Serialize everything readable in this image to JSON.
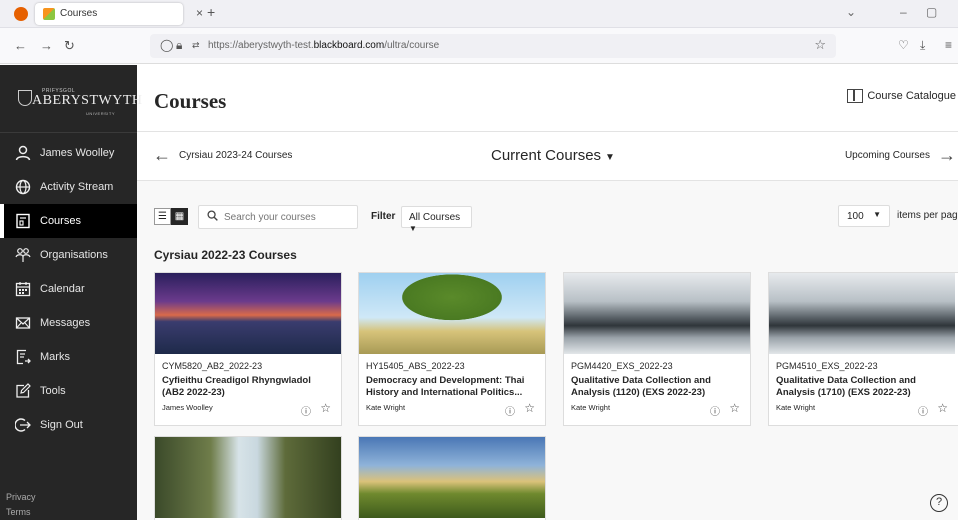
{
  "browser": {
    "tab_title": "Courses",
    "url_prefix": "https://aberystwyth-test.",
    "url_domain": "blackboard.com",
    "url_suffix": "/ultra/course"
  },
  "brand": {
    "small": "PRIFYSGOL",
    "name": "ABERYSTWYTH",
    "sub": "UNIVERSITY"
  },
  "sidebar": {
    "items": [
      {
        "label": "James Woolley",
        "icon": "user-icon"
      },
      {
        "label": "Activity Stream",
        "icon": "globe-icon"
      },
      {
        "label": "Courses",
        "icon": "courses-icon",
        "active": true
      },
      {
        "label": "Organisations",
        "icon": "organisations-icon"
      },
      {
        "label": "Calendar",
        "icon": "calendar-icon"
      },
      {
        "label": "Messages",
        "icon": "envelope-icon"
      },
      {
        "label": "Marks",
        "icon": "marks-icon"
      },
      {
        "label": "Tools",
        "icon": "tools-icon"
      },
      {
        "label": "Sign Out",
        "icon": "sign-out-icon"
      }
    ],
    "footer": [
      "Privacy",
      "Terms"
    ]
  },
  "header": {
    "title": "Courses",
    "catalogue": "Course Catalogue"
  },
  "term_nav": {
    "previous": "Cyrsiau 2023-24 Courses",
    "current": "Current Courses",
    "next": "Upcoming Courses"
  },
  "toolbar": {
    "search_placeholder": "Search your courses",
    "filter_label": "Filter",
    "filter_value": "All Courses",
    "per_page_value": "100",
    "per_page_label": "items per page"
  },
  "section_title": "Cyrsiau 2022-23 Courses",
  "courses": [
    {
      "code": "CYM5820_AB2_2022-23",
      "name": "Cyfieithu Creadigol Rhyngwladol (AB2 2022-23)",
      "instructor": "James Woolley"
    },
    {
      "code": "HY15405_ABS_2022-23",
      "name": "Democracy and Development: Thai History and International Politics...",
      "instructor": "Kate Wright"
    },
    {
      "code": "PGM4420_EXS_2022-23",
      "name": "Qualitative Data Collection and Analysis (1120) (EXS 2022-23)",
      "instructor": "Kate Wright"
    },
    {
      "code": "PGM4510_EXS_2022-23",
      "name": "Qualitative Data Collection and Analysis (1710) (EXS 2022-23)",
      "instructor": "Kate Wright"
    }
  ],
  "colors": {
    "sidebar_bg": "#262626",
    "active_bg": "#000000",
    "content_bg": "#f8f8f8"
  }
}
